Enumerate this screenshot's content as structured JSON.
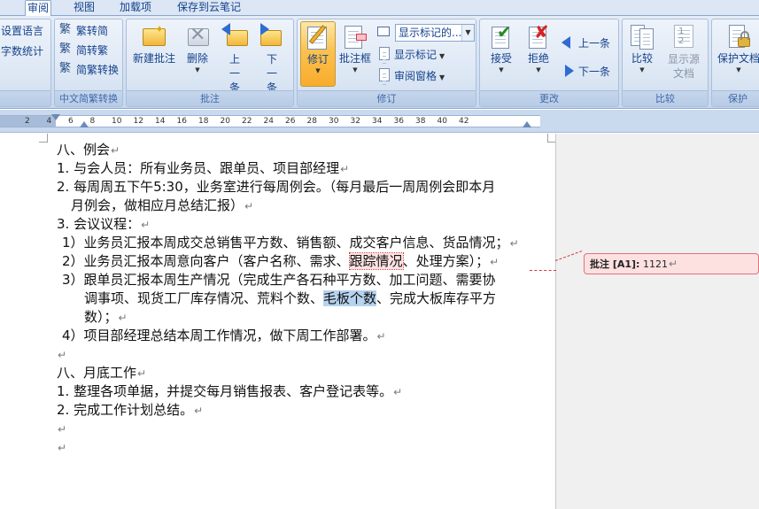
{
  "tabs": [
    "审阅",
    "视图",
    "加载项",
    "保存到云笔记"
  ],
  "ribbon": {
    "proofing": {
      "set_language": "设置语言",
      "word_count": "字数统计"
    },
    "chinese_conversion": {
      "trad_to_simp": "繁转简",
      "simp_to_trad": "简转繁",
      "convert": "简繁转换",
      "label": "中文简繁转换"
    },
    "comments": {
      "new_comment": "新建批注",
      "delete": "删除",
      "previous": "上一条",
      "next": "下一条",
      "label": "批注"
    },
    "tracking": {
      "track_changes": "修订",
      "balloons": "批注框",
      "display_for_review": "显示标记的...",
      "show_markup": "显示标记",
      "reviewing_pane": "审阅窗格",
      "label": "修订"
    },
    "changes": {
      "accept": "接受",
      "reject": "拒绝",
      "previous": "上一条",
      "next": "下一条",
      "label": "更改"
    },
    "compare": {
      "compare": "比较",
      "show_source": "显示源文档",
      "label": "比较"
    },
    "protect": {
      "protect_document": "保护文档",
      "label": "保护"
    }
  },
  "ruler": {
    "ticks": [
      "2",
      "4",
      "6",
      "8",
      "10",
      "12",
      "14",
      "16",
      "18",
      "20",
      "22",
      "24",
      "26",
      "28",
      "30",
      "32",
      "34",
      "36",
      "38",
      "40",
      "42"
    ]
  },
  "document": {
    "lines": [
      {
        "text": "八、例会"
      },
      {
        "text": "1. 与会人员：所有业务员、跟单员、项目部经理"
      },
      {
        "text": "2. 每周周五下午5:30，业务室进行每周例会。（每月最后一周周例会即本月"
      },
      {
        "text": "月例会，做相应月总结汇报）"
      },
      {
        "text": "3. 会议议程："
      },
      {
        "text": "1）业务员汇报本周成交总销售平方数、销售额、成交客户信息、货品情况；"
      },
      {
        "before": "2）业务员汇报本周意向客户（客户名称、需求、",
        "highlight": "跟踪情况",
        "after": "、处理方案）；"
      },
      {
        "text": "3）跟单员汇报本周生产情况（完成生产各石种平方数、加工问题、需要协"
      },
      {
        "before": "调事项、现货工厂库存情况、荒料个数、",
        "highlight": "毛板个数",
        "after": "、完成大板库存平方"
      },
      {
        "text": "数）；"
      },
      {
        "text": "4）项目部经理总结本周工作情况，做下周工作部署。"
      },
      {
        "text": ""
      },
      {
        "text": "八、月底工作"
      },
      {
        "text": "1. 整理各项单据，并提交每月销售报表、客户登记表等。"
      },
      {
        "text": "2. 完成工作计划总结。"
      },
      {
        "text": ""
      },
      {
        "text": ""
      }
    ],
    "paragraph_mark": "↵"
  },
  "comment": {
    "label": "批注 [A1]:",
    "text": "1121"
  },
  "colors": {
    "ribbon_text": "#15428b",
    "comment_fill": "#fde1e1",
    "comment_border": "#e0707a",
    "selection": "#b6d3f0"
  }
}
